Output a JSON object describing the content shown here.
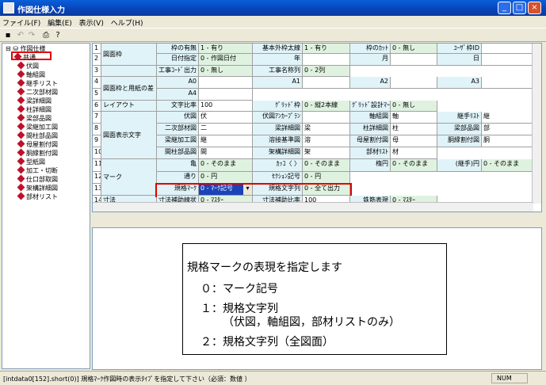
{
  "window": {
    "title": "作図仕様入力"
  },
  "menu": [
    "ファイル(F)",
    "編集(E)",
    "表示(V)",
    "ヘルプ(H)"
  ],
  "tree": {
    "root": "作図仕様",
    "items": [
      "共通",
      "伏図",
      "軸組図",
      "継手リスト",
      "二次部材図",
      "梁詳細図",
      "柱詳細図",
      "梁部品図",
      "梁継加工図",
      "間柱部品図",
      "母屋割付図",
      "胴縁割付図",
      "型紙図",
      "加工・切断",
      "仕口部取図",
      "架構詳細図",
      "部材リスト"
    ]
  },
  "grid": {
    "row_numbers": [
      "1",
      "2",
      "3",
      "4",
      "5",
      "6",
      "7",
      "8",
      "9",
      "10",
      "11",
      "12",
      "13",
      "14"
    ],
    "groups": [
      "図面枠",
      "図面枠と用紙の差",
      "レイアウト",
      "図面表示文字",
      "マーク",
      "寸法"
    ],
    "rows": {
      "r1": [
        "枠の有無",
        "1 - 有り",
        "基本外枠太線",
        "1 - 有り",
        "枠のｶｯﾄ",
        "0 - 無し",
        "ﾕｰｻﾞ枠ID",
        ""
      ],
      "r2": [
        "日付指定",
        "0 - 作図日付",
        "年",
        "",
        "月",
        "",
        "日",
        ""
      ],
      "r3": [
        "工事ｺｰﾄﾞ出力",
        "0 - 無し",
        "工事名称列",
        "0 - 2列"
      ],
      "r4": [
        "A0",
        "",
        "A1",
        "",
        "A2",
        "",
        "A3",
        ""
      ],
      "r5": [
        "A4",
        ""
      ],
      "r6": [
        "文字比率",
        "100",
        "ｸﾞﾘｯﾄﾞ枠",
        "0 - 縦2本線",
        "ｸﾞﾘｯﾄﾞ設計ﾏｰｸ",
        "0 - 無し"
      ],
      "r7": [
        "伏図",
        "伏",
        "伏図ｱﾝｶｰﾌﾟﾗﾝ",
        "",
        "軸組図",
        "軸",
        "継手ﾘｽﾄ",
        "継"
      ],
      "r8": [
        "二次部材図",
        "二",
        "梁詳細図",
        "梁",
        "柱詳細図",
        "柱",
        "梁部品図",
        "部"
      ],
      "r9": [
        "梁継加工図",
        "継",
        "溶接基準図",
        "溶",
        "母屋割付図",
        "母",
        "胴縁割付図",
        "胴"
      ],
      "r10": [
        "間柱部品図",
        "間",
        "架構詳細図",
        "架",
        "部材ﾘｽﾄ",
        "材"
      ],
      "r11": [
        "亀",
        "0 - そのまま",
        "ｶｯｺ〈 〉",
        "0 - そのまま",
        "楕円",
        "0 - そのまま",
        "(継手)円",
        "0 - そのまま"
      ],
      "r12": [
        "通り",
        "0 - 円",
        "ｾｸｼｮﾝ記号",
        "0 - 円"
      ],
      "r13": [
        "規格ﾏｰｸ",
        "0 - ﾏｰｸ記号",
        "規格文字列",
        "0 - 全て出力"
      ],
      "r14": [
        "寸法補助線状",
        "0 - ﾏｽﾀｰ",
        "寸法補助比率",
        "100",
        "鉄筋表現",
        "0 - ﾏｽﾀｰ"
      ]
    }
  },
  "description": {
    "title": "規格マークの表現を指定します",
    "opt0": "０：マーク記号",
    "opt1": "１：規格文字列",
    "opt1b": "（伏図，軸組図，部材リストのみ）",
    "opt2": "２：規格文字列（全図面）"
  },
  "status": {
    "text": "[intdata0[152].short(0)] 規格ﾏｰｸ作図時の表示ﾀｲﾌﾟを指定して下さい（必須：数値 ）",
    "num": "NUM"
  }
}
